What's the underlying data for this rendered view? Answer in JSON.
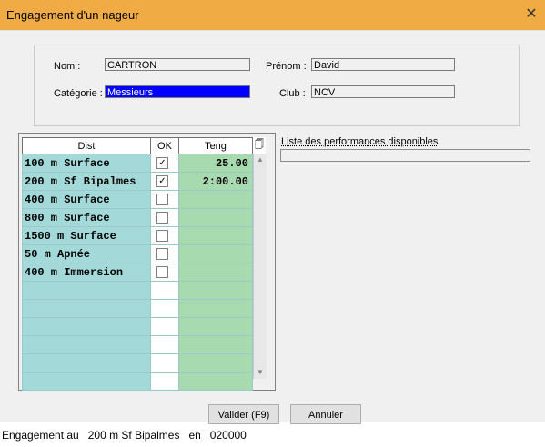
{
  "window": {
    "title": "Engagement d'un nageur",
    "close_icon": "close-icon"
  },
  "form": {
    "nom_label": "Nom :",
    "nom_value": "CARTRON",
    "prenom_label": "Prénom :",
    "prenom_value": "David",
    "categorie_label": "Catégorie :",
    "categorie_value": "Messieurs",
    "club_label": "Club :",
    "club_value": "NCV"
  },
  "grid": {
    "headers": {
      "dist": "Dist",
      "ok": "OK",
      "teng": "Teng"
    },
    "rows": [
      {
        "dist": " 100 m Surface",
        "ok": true,
        "teng": "25.00"
      },
      {
        "dist": " 200 m Sf Bipalmes",
        "ok": true,
        "teng": "2:00.00"
      },
      {
        "dist": " 400 m Surface",
        "ok": false,
        "teng": ""
      },
      {
        "dist": " 800 m Surface",
        "ok": false,
        "teng": ""
      },
      {
        "dist": "1500 m Surface",
        "ok": false,
        "teng": ""
      },
      {
        "dist": "  50 m Apnée",
        "ok": false,
        "teng": ""
      },
      {
        "dist": " 400 m Immersion",
        "ok": false,
        "teng": ""
      }
    ]
  },
  "performances": {
    "label": "Liste des performances disponibles"
  },
  "buttons": {
    "valider": "Valider (F9)",
    "annuler": "Annuler"
  },
  "status": {
    "text": "Engagement au   200 m Sf Bipalmes   en   020000"
  }
}
